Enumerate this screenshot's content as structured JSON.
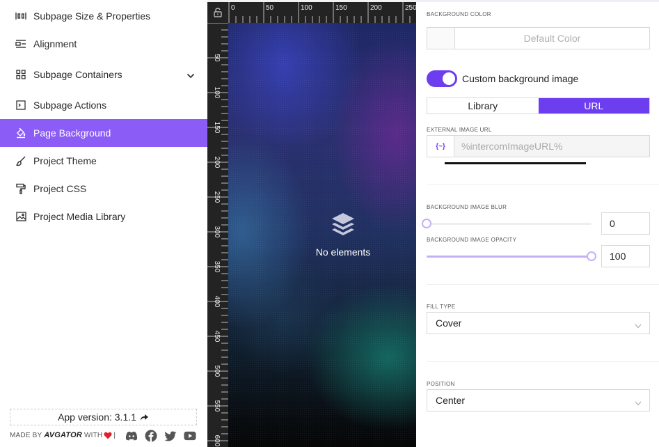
{
  "sidebar": {
    "items": [
      {
        "label": "Subpage Size & Properties",
        "icon": "size-properties-icon"
      },
      {
        "label": "Alignment",
        "icon": "alignment-icon"
      },
      {
        "label": "Subpage Containers",
        "icon": "grid-icon"
      },
      {
        "label": "Subpage Actions",
        "icon": "terminal-icon"
      },
      {
        "label": "Page Background",
        "icon": "paint-bucket-icon"
      },
      {
        "label": "Project Theme",
        "icon": "brush-icon"
      },
      {
        "label": "Project CSS",
        "icon": "paint-roller-icon"
      },
      {
        "label": "Project Media Library",
        "icon": "image-icon"
      }
    ],
    "active_index": 4,
    "accent": "#8b5cf6",
    "version_text": "App version: 3.1.1",
    "made_by_prefix": "MADE BY",
    "brand": "AVGATOR",
    "with_text": "WITH",
    "separator": "|",
    "socials": [
      "discord-icon",
      "facebook-icon",
      "twitter-icon",
      "youtube-icon"
    ]
  },
  "canvas": {
    "ruler_h": [
      "0",
      "50",
      "100",
      "150",
      "200",
      "250"
    ],
    "ruler_v": [
      "50",
      "100",
      "150",
      "200",
      "250",
      "300",
      "350",
      "400",
      "450",
      "500",
      "550",
      "600"
    ],
    "empty_text": "No elements"
  },
  "panel": {
    "bg_color_label": "BACKGROUND COLOR",
    "bg_color_value": "Default Color",
    "custom_bg_label": "Custom background image",
    "custom_bg_on": true,
    "source_tabs": [
      "Library",
      "URL"
    ],
    "source_active": "URL",
    "ext_url_label": "EXTERNAL IMAGE URL",
    "ext_url_var": "{~}",
    "ext_url_placeholder": "%intercomImageURL%",
    "blur_label": "BACKGROUND IMAGE BLUR",
    "blur_value": "0",
    "blur_fraction": 0,
    "opacity_label": "BACKGROUND IMAGE OPACITY",
    "opacity_value": "100",
    "opacity_fraction": 1,
    "fill_type_label": "FILL TYPE",
    "fill_type_value": "Cover",
    "position_label": "POSITION",
    "position_value": "Center",
    "accent": "#6d3df0"
  }
}
